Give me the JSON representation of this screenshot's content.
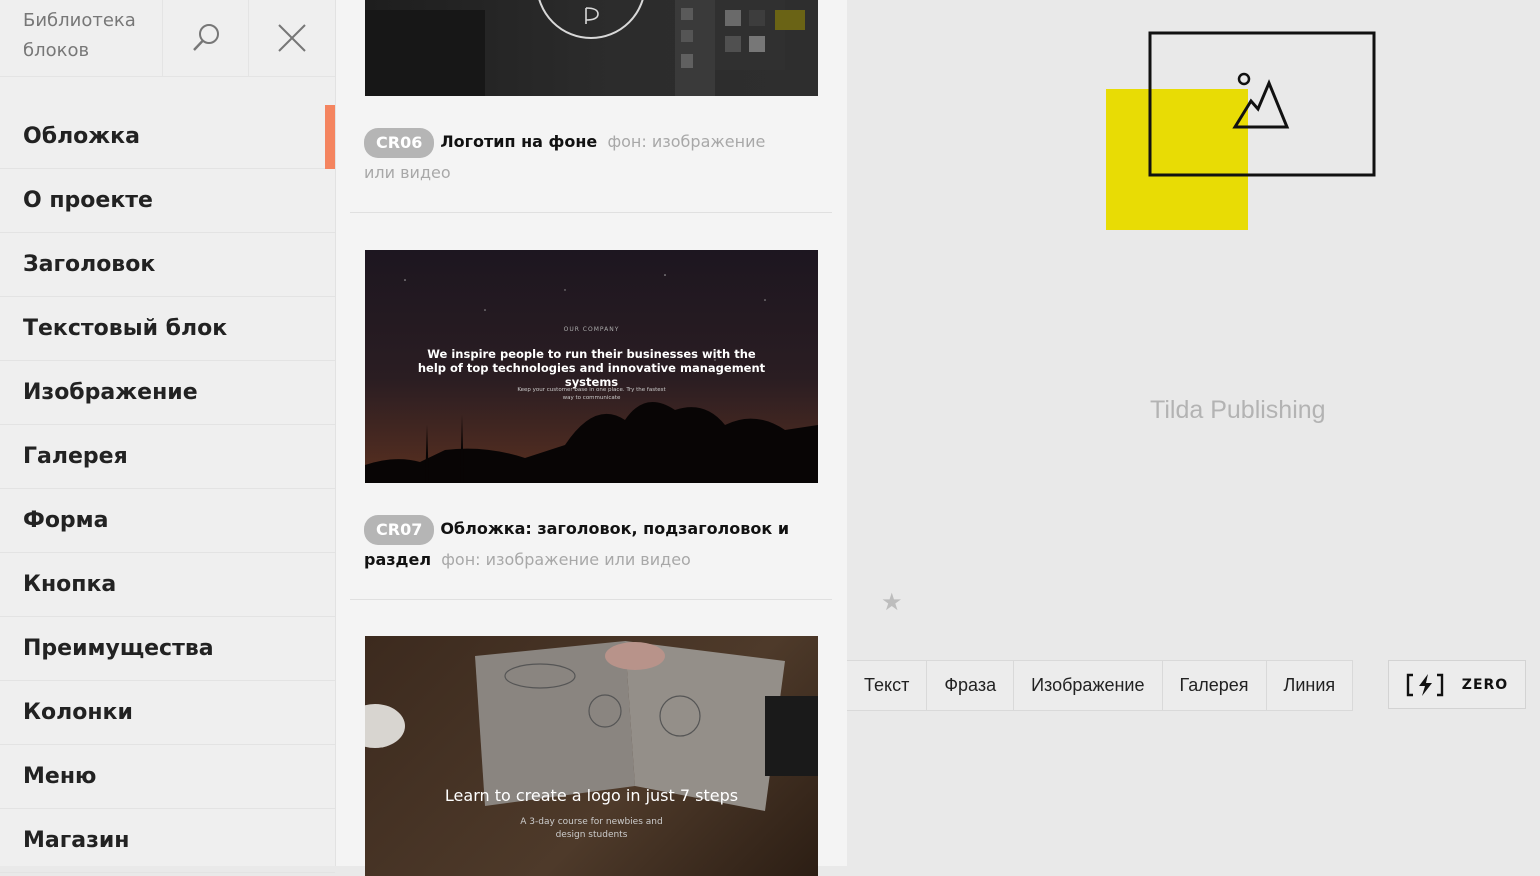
{
  "sidebar": {
    "title": "Библиотека блоков",
    "items": [
      {
        "label": "Обложка",
        "active": true
      },
      {
        "label": "О проекте"
      },
      {
        "label": "Заголовок"
      },
      {
        "label": "Текстовый блок"
      },
      {
        "label": "Изображение"
      },
      {
        "label": "Галерея"
      },
      {
        "label": "Форма"
      },
      {
        "label": "Кнопка"
      },
      {
        "label": "Преимущества"
      },
      {
        "label": "Колонки"
      },
      {
        "label": "Меню"
      },
      {
        "label": "Магазин"
      }
    ],
    "accent_color": "#f4845f"
  },
  "blocks": [
    {
      "code": "CR06",
      "title": "Логотип на фоне",
      "subtitle": "фон: изображение или видео"
    },
    {
      "code": "CR07",
      "title": "Обложка: заголовок, подзаголовок и раздел",
      "subtitle": "фон: изображение или видео",
      "preview": {
        "eyebrow": "OUR COMPANY",
        "headline": "We inspire people to run their businesses with the help of top technologies and innovative management systems",
        "body": "Keep your customer base in one place. Try the fastest way to communicate"
      }
    },
    {
      "preview": {
        "headline": "Learn to create a logo in just 7 steps",
        "body": "A 3-day course for newbies and design students"
      }
    }
  ],
  "canvas": {
    "brand": "Tilda Publishing",
    "placeholder_color": "#e8dc05",
    "toolbar": [
      "Текст",
      "Фраза",
      "Изображение",
      "Галерея",
      "Линия"
    ],
    "zero_label": "ZERO"
  }
}
